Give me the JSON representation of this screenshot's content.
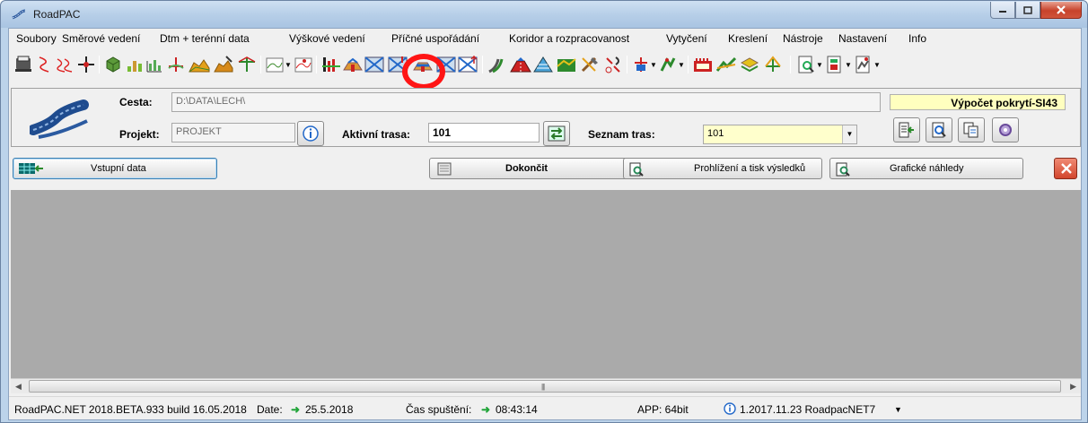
{
  "window": {
    "title": "RoadPAC"
  },
  "menu": [
    "Soubory",
    "Směrové vedení",
    "Dtm + terénní data",
    "Výškové vedení",
    "Příčné uspořádání",
    "Koridor a rozpracovanost",
    "Vytyčení",
    "Kreslení",
    "Nástroje",
    "Nastavení",
    "Info"
  ],
  "toolbar_icons": [
    "print-stack-icon",
    "horizontal-curve-icon",
    "reverse-curve-icon",
    "crosshair-icon",
    "terrain-cube-icon",
    "terrain-points-icon",
    "profile-bars-icon",
    "profile-cross-icon",
    "terrain-surface-icon",
    "terrain-edit-icon",
    "terrain-axis-icon",
    "vertical-profile-icon",
    "vertical-profile-edit-icon",
    "cross-section-bars-icon",
    "cross-section-road-icon",
    "cross-section-grid-icon",
    "cross-section-grid-edit-icon",
    "corridor-icon",
    "corridor-build-icon",
    "corridor-table-icon",
    "corridor-terrain-icon",
    "tools-icon",
    "setout-icon",
    "cross-road-icon",
    "drawing-icon",
    "chart-icon",
    "road-3d-icon",
    "road-paint-icon",
    "ruler-icon",
    "preview-icon",
    "export-icon",
    "export-3d-icon"
  ],
  "header": {
    "cesta_label": "Cesta:",
    "cesta_value": "D:\\DATA\\LECH\\",
    "projekt_label": "Projekt:",
    "projekt_value": "PROJEKT",
    "aktivni_label": "Aktivní trasa:",
    "aktivni_value": "101",
    "seznam_label": "Seznam tras:",
    "seznam_value": "101",
    "calc_label": "Výpočet pokrytí-SI43"
  },
  "actions": {
    "vstupni": "Vstupní data",
    "dokoncit": "Dokončit",
    "prohlizeni": "Prohlížení a tisk výsledků",
    "graficke": "Grafické náhledy"
  },
  "status": {
    "version": "RoadPAC.NET 2018.BETA.933 build 16.05.2018",
    "date_label": "Date:",
    "date_value": "25.5.2018",
    "cas_label": "Čas spuštění:",
    "cas_value": "08:43:14",
    "app": "APP: 64bit",
    "build": "1.2017.11.23 RoadpacNET7"
  },
  "colors": {
    "accent_green": "#22a53a",
    "highlight_red": "#ff1515",
    "calc_yellow": "#ffffbf",
    "content_gray": "#aaaaaa"
  }
}
